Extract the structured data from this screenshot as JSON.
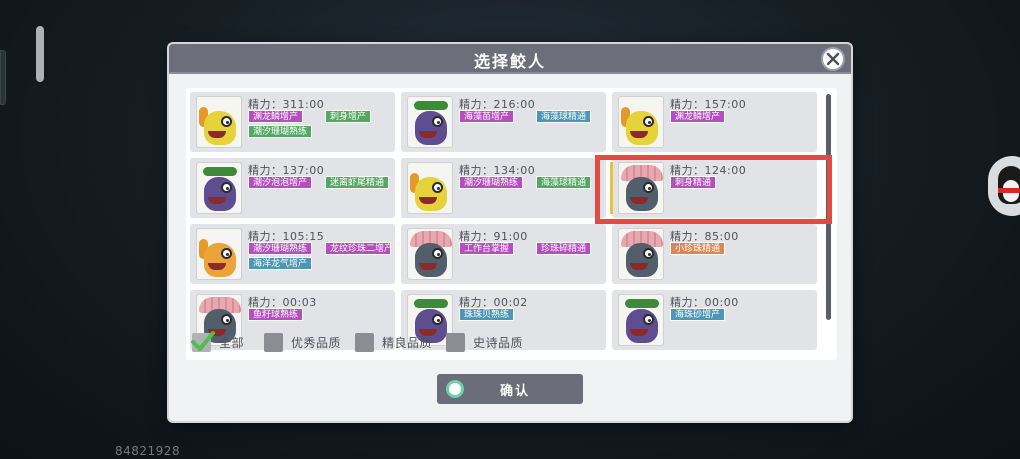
{
  "background": {
    "player_id": "84821928"
  },
  "modal": {
    "title": "选择鲛人",
    "close_icon": "close-icon",
    "confirm_label": "确认"
  },
  "filters": [
    {
      "label": "全部",
      "checked": true
    },
    {
      "label": "优秀品质",
      "checked": false
    },
    {
      "label": "精良品质",
      "checked": false
    },
    {
      "label": "史诗品质",
      "checked": false
    }
  ],
  "cards": [
    {
      "power": "精力：311:00",
      "species": "yellow",
      "tags": [
        {
          "text": "渊龙鳞增产",
          "color": "purple"
        },
        {
          "text": "刺身增产",
          "color": "green"
        },
        {
          "text": "潮汐珊瑚熟练",
          "color": "green"
        }
      ]
    },
    {
      "power": "精力：216:00",
      "species": "purple",
      "tags": [
        {
          "text": "海藻苗增产",
          "color": "purple"
        },
        {
          "text": "海藻球精通",
          "color": "blue"
        }
      ]
    },
    {
      "power": "精力：157:00",
      "species": "yellow",
      "tags": [
        {
          "text": "渊龙鳞增产",
          "color": "purple"
        }
      ]
    },
    {
      "power": "精力：137:00",
      "species": "purple",
      "tags": [
        {
          "text": "潮汐泡泡增产",
          "color": "purple"
        },
        {
          "text": "迷离虾尾精通",
          "color": "green"
        }
      ]
    },
    {
      "power": "精力：134:00",
      "species": "yellow",
      "tags": [
        {
          "text": "潮汐珊瑚熟练",
          "color": "purple"
        },
        {
          "text": "海藻球精通",
          "color": "green"
        }
      ]
    },
    {
      "power": "精力：124:00",
      "species": "shell",
      "tags": [
        {
          "text": "刺身精通",
          "color": "purple"
        }
      ]
    },
    {
      "power": "精力：105:15",
      "species": "orange",
      "tags": [
        {
          "text": "潮汐珊瑚熟练",
          "color": "purple"
        },
        {
          "text": "龙纹珍珠二增产",
          "color": "purple"
        },
        {
          "text": "海洋龙气增产",
          "color": "blue"
        }
      ]
    },
    {
      "power": "精力：91:00",
      "species": "shell",
      "tags": [
        {
          "text": "工作台掌握",
          "color": "purple"
        },
        {
          "text": "珍珠碎精通",
          "color": "purple"
        }
      ]
    },
    {
      "power": "精力：85:00",
      "species": "shell",
      "tags": [
        {
          "text": "小珍珠精通",
          "color": "orange"
        }
      ]
    },
    {
      "power": "精力：00:03",
      "species": "shell",
      "tags": [
        {
          "text": "鱼籽球熟练",
          "color": "purple"
        }
      ]
    },
    {
      "power": "精力：00:02",
      "species": "purple",
      "tags": [
        {
          "text": "珠珠贝熟练",
          "color": "blue"
        }
      ]
    },
    {
      "power": "精力：00:00",
      "species": "purple",
      "tags": [
        {
          "text": "海珠砂增产",
          "color": "blue"
        }
      ]
    }
  ],
  "colors": {
    "header": "#6c6e7a",
    "tag_purple": "#b54fbf",
    "tag_green": "#55a864",
    "tag_blue": "#4b97b5",
    "tag_orange": "#d98755",
    "highlight": "#e24a42"
  }
}
